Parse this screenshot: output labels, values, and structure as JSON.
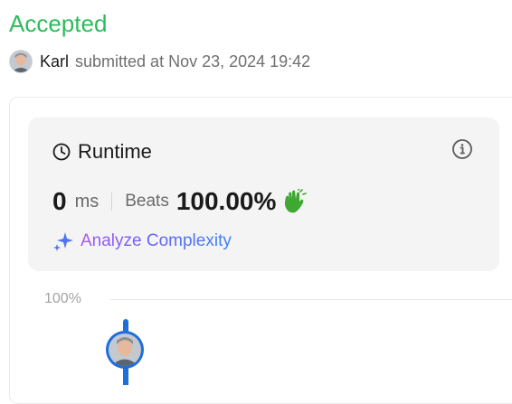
{
  "submission": {
    "status": "Accepted",
    "username": "Karl",
    "submitted_text": "submitted at Nov 23, 2024 19:42"
  },
  "runtime": {
    "title": "Runtime",
    "value": "0",
    "unit": "ms",
    "beats_label": "Beats",
    "beats_value": "100.00%",
    "analyze_label": "Analyze Complexity"
  },
  "chart": {
    "y_tick_label": "100%"
  },
  "colors": {
    "accepted": "#2cbb5d",
    "card_bg": "#f4f4f5",
    "bar": "#1e6fd9",
    "clap": "#3fa832"
  },
  "icons": [
    "clock-icon",
    "info-icon",
    "clap-icon",
    "sparkle-icon"
  ]
}
